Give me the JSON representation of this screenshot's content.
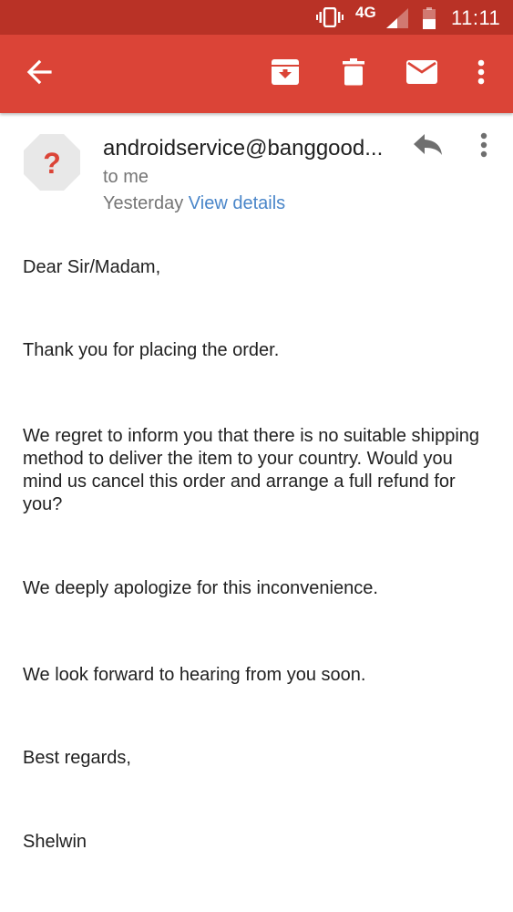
{
  "status_bar": {
    "network": "4G",
    "time": "11:11",
    "icons": [
      "vibrate-icon",
      "signal-icon",
      "battery-icon"
    ]
  },
  "toolbar": {
    "icons": [
      "back-arrow-icon",
      "archive-icon",
      "trash-icon",
      "mail-icon",
      "more-vert-icon"
    ],
    "color": "#db4437",
    "status_color": "#b93226"
  },
  "message": {
    "avatar_glyph": "?",
    "avatar_color": "#e8e8e8",
    "sender": "androidservice@banggood...",
    "recipient": "to me",
    "date": "Yesterday",
    "view_details": "View details",
    "link_color": "#4a86c9"
  },
  "body": {
    "greeting": "Dear Sir/Madam,",
    "thanks": "Thank you for placing the order.",
    "regret": "We regret to inform you that there is no suitable shipping method to deliver the item to your country. Would you mind us cancel this order and arrange a full refund for you?",
    "apology": "We deeply apologize for this inconvenience.",
    "forward": "We look forward to hearing from you soon.",
    "closing": "Best regards,",
    "signature": "Shelwin"
  }
}
